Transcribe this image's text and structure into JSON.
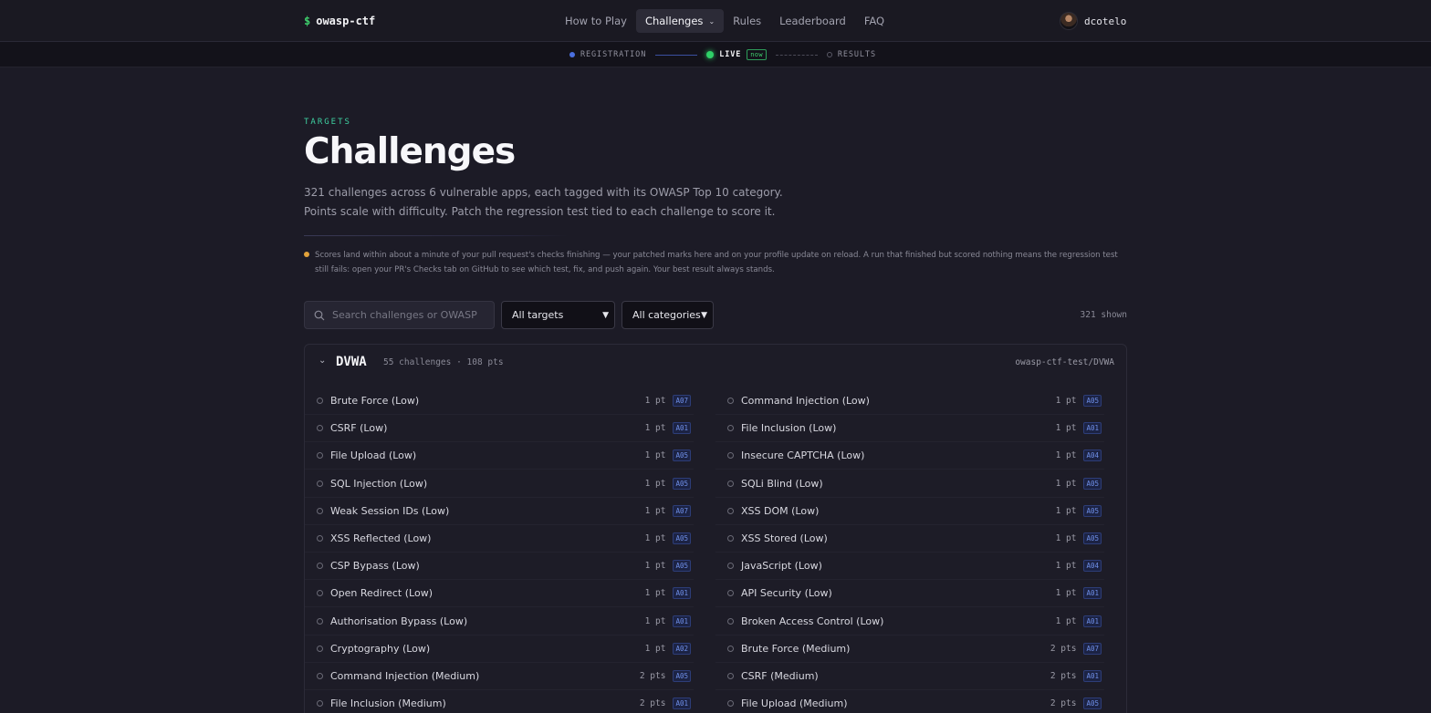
{
  "brand": {
    "symbol": "$",
    "name": "owasp-ctf"
  },
  "nav": {
    "items": [
      "How to Play",
      "Challenges",
      "Rules",
      "Leaderboard",
      "FAQ"
    ],
    "active": "Challenges"
  },
  "user": {
    "name": "dcotelo"
  },
  "phases": {
    "registration": "REGISTRATION",
    "live": "LIVE",
    "now": "now",
    "results": "RESULTS"
  },
  "header": {
    "eyebrow": "TARGETS",
    "title": "Challenges",
    "intro": "321 challenges across 6 vulnerable apps, each tagged with its OWASP Top 10 category. Points scale with difficulty. Patch the regression test tied to each challenge to score it."
  },
  "notice": "Scores land within about a minute of your pull request's checks finishing — your patched marks here and on your profile update on reload. A run that finished but scored nothing means the regression test still fails: open your PR's Checks tab on GitHub to see which test, fix, and push again. Your best result always stands.",
  "filters": {
    "search_placeholder": "Search challenges or OWASP co",
    "targets_selected": "All targets",
    "categories_selected": "All categories",
    "shown_count": "321 shown"
  },
  "target": {
    "name": "DVWA",
    "meta": "55 challenges · 108 pts",
    "repo": "owasp-ctf-test/DVWA",
    "challenges": [
      {
        "name": "Brute Force (Low)",
        "pts": "1 pt",
        "tag": "A07"
      },
      {
        "name": "Command Injection (Low)",
        "pts": "1 pt",
        "tag": "A05"
      },
      {
        "name": "CSRF (Low)",
        "pts": "1 pt",
        "tag": "A01"
      },
      {
        "name": "File Inclusion (Low)",
        "pts": "1 pt",
        "tag": "A01"
      },
      {
        "name": "File Upload (Low)",
        "pts": "1 pt",
        "tag": "A05"
      },
      {
        "name": "Insecure CAPTCHA (Low)",
        "pts": "1 pt",
        "tag": "A04"
      },
      {
        "name": "SQL Injection (Low)",
        "pts": "1 pt",
        "tag": "A05"
      },
      {
        "name": "SQLi Blind (Low)",
        "pts": "1 pt",
        "tag": "A05"
      },
      {
        "name": "Weak Session IDs (Low)",
        "pts": "1 pt",
        "tag": "A07"
      },
      {
        "name": "XSS DOM (Low)",
        "pts": "1 pt",
        "tag": "A05"
      },
      {
        "name": "XSS Reflected (Low)",
        "pts": "1 pt",
        "tag": "A05"
      },
      {
        "name": "XSS Stored (Low)",
        "pts": "1 pt",
        "tag": "A05"
      },
      {
        "name": "CSP Bypass (Low)",
        "pts": "1 pt",
        "tag": "A05"
      },
      {
        "name": "JavaScript (Low)",
        "pts": "1 pt",
        "tag": "A04"
      },
      {
        "name": "Open Redirect (Low)",
        "pts": "1 pt",
        "tag": "A01"
      },
      {
        "name": "API Security (Low)",
        "pts": "1 pt",
        "tag": "A01"
      },
      {
        "name": "Authorisation Bypass (Low)",
        "pts": "1 pt",
        "tag": "A01"
      },
      {
        "name": "Broken Access Control (Low)",
        "pts": "1 pt",
        "tag": "A01"
      },
      {
        "name": "Cryptography (Low)",
        "pts": "1 pt",
        "tag": "A02"
      },
      {
        "name": "Brute Force (Medium)",
        "pts": "2 pts",
        "tag": "A07"
      },
      {
        "name": "Command Injection (Medium)",
        "pts": "2 pts",
        "tag": "A05"
      },
      {
        "name": "CSRF (Medium)",
        "pts": "2 pts",
        "tag": "A01"
      },
      {
        "name": "File Inclusion (Medium)",
        "pts": "2 pts",
        "tag": "A01"
      },
      {
        "name": "File Upload (Medium)",
        "pts": "2 pts",
        "tag": "A05"
      }
    ]
  }
}
